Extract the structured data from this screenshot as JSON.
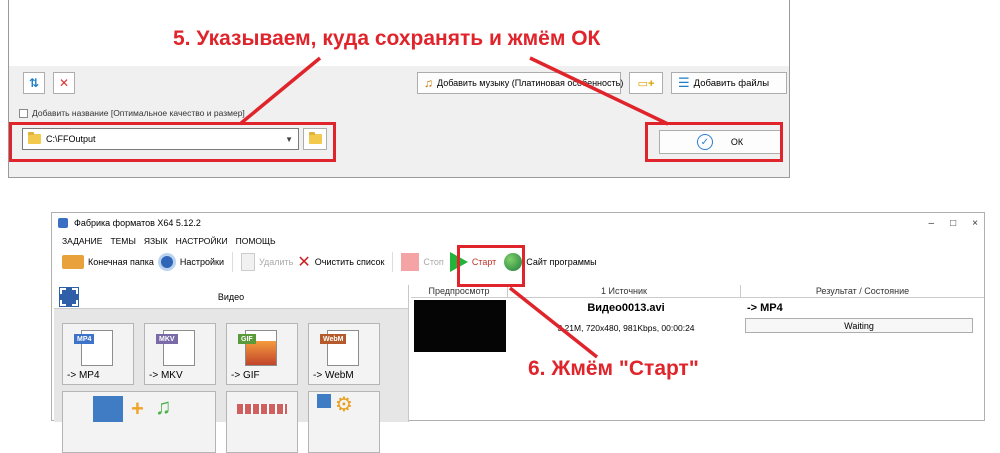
{
  "dialog": {
    "add_name_checkbox_label": "Добавить название [Оптимальное качество и размер]",
    "add_music_label": "Добавить музыку (Платиновая особенность)",
    "add_file_label": "Добавить файлы",
    "output_path": "C:\\FFOutput",
    "ok_label": "ОК"
  },
  "annotations": {
    "step5": "5. Указываем, куда сохранять и жмём ОК",
    "step6": "6. Жмём \"Старт\"",
    "color": "#e0242b"
  },
  "app": {
    "title": "Фабрика форматов X64 5.12.2",
    "window_controls": {
      "minimize": "–",
      "maximize": "□",
      "close": "×"
    },
    "menu": [
      "ЗАДАНИЕ",
      "ТЕМЫ",
      "ЯЗЫК",
      "НАСТРОЙКИ",
      "ПОМОЩЬ"
    ],
    "toolbar": {
      "output_folder": "Конечная папка",
      "settings": "Настройки",
      "remove": "Удалить",
      "clear_list": "Очистить список",
      "stop": "Стоп",
      "start": "Старт",
      "website": "Сайт программы"
    },
    "left_pane": {
      "category": "Видео",
      "tiles": [
        {
          "badge": "MP4",
          "label": "-> MP4",
          "color": "#3d73c8"
        },
        {
          "badge": "MKV",
          "label": "-> MKV",
          "color": "#7a6aa8"
        },
        {
          "badge": "GIF",
          "label": "-> GIF",
          "color": "#5a9a3a"
        },
        {
          "badge": "WebM",
          "label": "-> WebM",
          "color": "#b55a2a"
        }
      ]
    },
    "table": {
      "columns": [
        "Предпросмотр",
        "1 Источник",
        "Результат / Состояние"
      ],
      "rows": [
        {
          "filename": "Видео0013.avi",
          "info": "3.21M, 720x480, 981Kbps, 00:00:24",
          "target": "-> MP4",
          "status": "Waiting"
        }
      ]
    }
  }
}
